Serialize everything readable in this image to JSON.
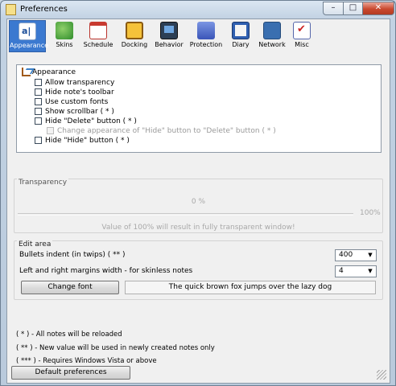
{
  "window": {
    "title": "Preferences",
    "minimize_glyph": "–",
    "maximize_glyph": "□",
    "close_glyph": "✕"
  },
  "toolbar": {
    "items": [
      {
        "label": "Appearance",
        "icon": "appearance-icon",
        "active": true
      },
      {
        "label": "Skins",
        "icon": "skins-icon"
      },
      {
        "label": "Schedule",
        "icon": "schedule-icon"
      },
      {
        "label": "Docking",
        "icon": "docking-icon"
      },
      {
        "label": "Behavior",
        "icon": "behavior-icon"
      },
      {
        "label": "Protection",
        "icon": "protection-icon"
      },
      {
        "label": "Diary",
        "icon": "diary-icon"
      },
      {
        "label": "Network",
        "icon": "network-icon"
      },
      {
        "label": "Misc",
        "icon": "misc-icon"
      }
    ]
  },
  "tree": {
    "root": "Appearance",
    "items": [
      {
        "label": "Allow transparency",
        "checked": false
      },
      {
        "label": "Hide note's toolbar",
        "checked": false
      },
      {
        "label": "Use custom fonts",
        "checked": false
      },
      {
        "label": "Show scrollbar ( * )",
        "checked": false
      },
      {
        "label": "Hide \"Delete\" button ( * )",
        "checked": false
      },
      {
        "label": "Change appearance of \"Hide\" button to \"Delete\" button ( * )",
        "checked": false,
        "disabled": true
      },
      {
        "label": "Hide \"Hide\" button ( * )",
        "checked": false
      }
    ]
  },
  "transparency": {
    "caption": "Transparency",
    "value_text": "0 %",
    "max_text": "100%",
    "note": "Value of 100% will result in fully transparent window!"
  },
  "edit_area": {
    "caption": "Edit area",
    "bullets_label": "Bullets indent (in twips) ( ** )",
    "bullets_value": "400",
    "margins_label": "Left and right margins width - for skinless notes",
    "margins_value": "4",
    "change_font_label": "Change font",
    "preview_text": "The quick brown fox jumps over the lazy dog"
  },
  "legend": {
    "one_star": "( * ) - All notes will be reloaded",
    "two_stars": "( ** ) - New value will be used in newly created notes only",
    "three_stars": "( *** ) - Requires Windows Vista or above"
  },
  "footer": {
    "default_label": "Default preferences"
  },
  "colors": {
    "selected_tab": "#3b79d0",
    "titlebar": "#c2d2e3",
    "close_button": "#c9492f"
  }
}
